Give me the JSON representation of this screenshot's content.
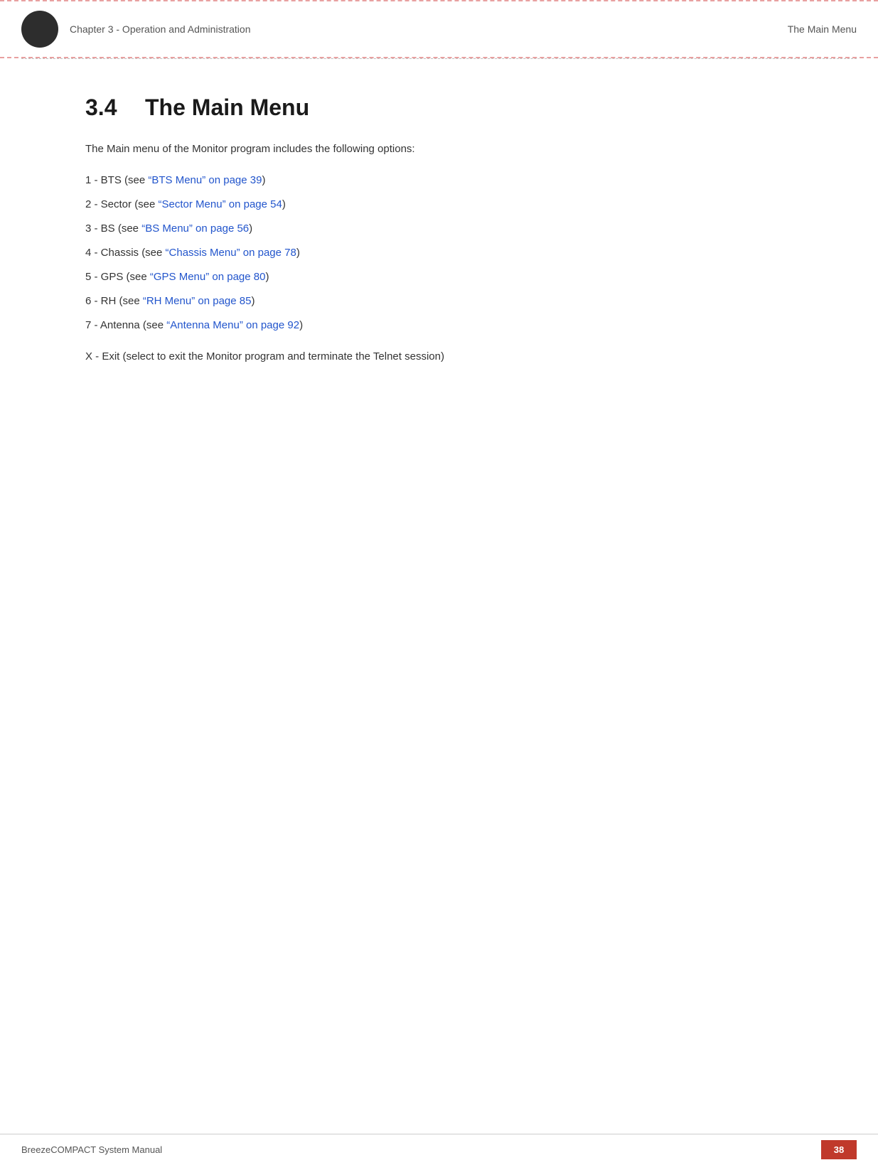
{
  "header": {
    "chapter_label": "Chapter 3 - Operation and Administration",
    "section_label": "The Main Menu",
    "circle_color": "#2d2d2d"
  },
  "section": {
    "number": "3.4",
    "title": "The Main Menu",
    "intro": "The Main menu of the Monitor program includes the following options:"
  },
  "menu_items": [
    {
      "prefix": "1 - BTS (see ",
      "link_text": "“BTS Menu” on page 39",
      "suffix": ")"
    },
    {
      "prefix": "2 - Sector (see ",
      "link_text": "“Sector Menu” on page 54",
      "suffix": ")"
    },
    {
      "prefix": "3 - BS (see ",
      "link_text": "“BS Menu” on page 56",
      "suffix": ")"
    },
    {
      "prefix": "4 - Chassis (see ",
      "link_text": "“Chassis Menu” on page 78",
      "suffix": ")"
    },
    {
      "prefix": "5 - GPS (see ",
      "link_text": "“GPS Menu” on page 80",
      "suffix": ")"
    },
    {
      "prefix": "6 - RH (see ",
      "link_text": "“RH Menu” on page 85",
      "suffix": ")"
    },
    {
      "prefix": "7 - Antenna (see ",
      "link_text": "“Antenna Menu” on page 92",
      "suffix": ")"
    }
  ],
  "exit_item": "X - Exit (select to exit the Monitor program and terminate the Telnet session)",
  "footer": {
    "brand": "BreezeCOMPACT System Manual",
    "page_number": "38"
  }
}
